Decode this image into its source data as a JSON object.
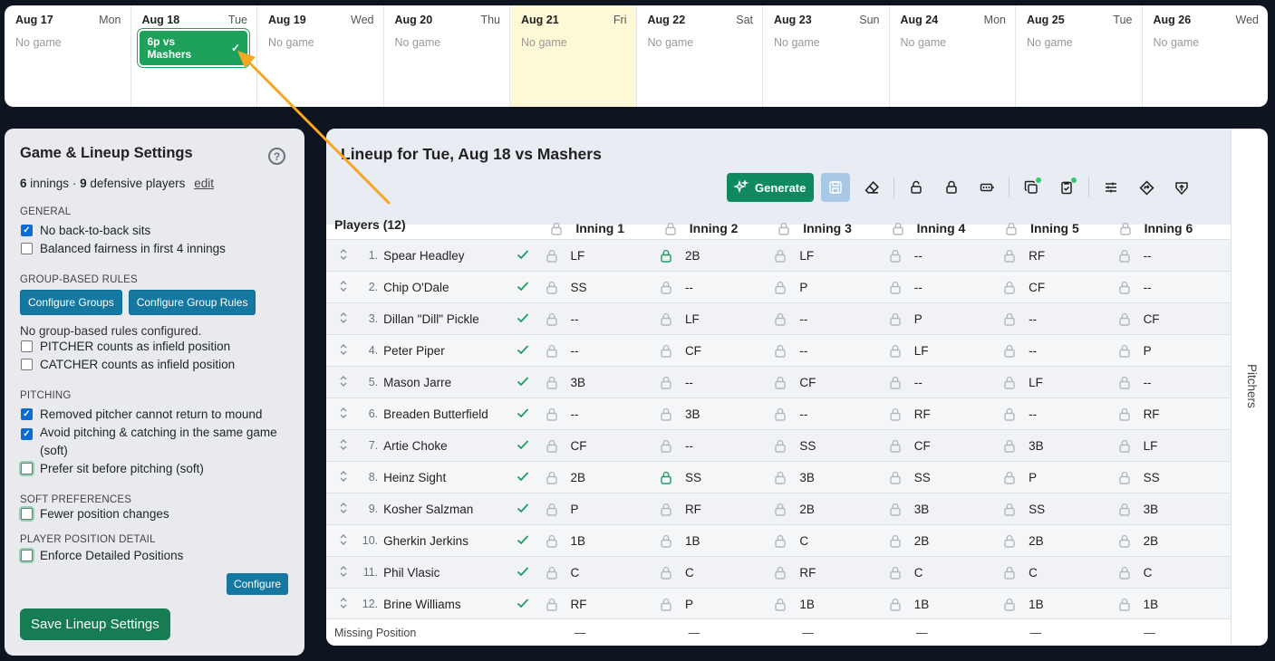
{
  "calendar": [
    {
      "date": "Aug 17",
      "dow": "Mon",
      "status": "No game"
    },
    {
      "date": "Aug 18",
      "dow": "Tue",
      "game": "6p vs Mashers",
      "check": "✓"
    },
    {
      "date": "Aug 19",
      "dow": "Wed",
      "status": "No game"
    },
    {
      "date": "Aug 20",
      "dow": "Thu",
      "status": "No game"
    },
    {
      "date": "Aug 21",
      "dow": "Fri",
      "status": "No game"
    },
    {
      "date": "Aug 22",
      "dow": "Sat",
      "status": "No game"
    },
    {
      "date": "Aug 23",
      "dow": "Sun",
      "status": "No game"
    },
    {
      "date": "Aug 24",
      "dow": "Mon",
      "status": "No game"
    },
    {
      "date": "Aug 25",
      "dow": "Tue",
      "status": "No game"
    },
    {
      "date": "Aug 26",
      "dow": "Wed",
      "status": "No game"
    }
  ],
  "settings": {
    "title": "Game & Lineup Settings",
    "help": "?",
    "innings": "6",
    "innings_label": "innings ·",
    "players": "9",
    "players_label": "defensive players",
    "edit": "edit",
    "general": "GENERAL",
    "no_b2b": "No back-to-back sits",
    "balanced": "Balanced fairness in first 4 innings",
    "group_rules": "GROUP-BASED RULES",
    "cfg_groups": "Configure Groups",
    "cfg_group_rules": "Configure Group Rules",
    "no_group": "No group-based rules configured.",
    "pitcher_if": "PITCHER counts as infield position",
    "catcher_if": "CATCHER counts as infield position",
    "pitching": "PITCHING",
    "removed": "Removed pitcher cannot return to mound",
    "avoid": "Avoid pitching & catching in the same game (soft)",
    "prefer": "Prefer sit before pitching (soft)",
    "soft": "SOFT PREFERENCES",
    "fewer": "Fewer position changes",
    "detail": "PLAYER POSITION DETAIL",
    "enforce": "Enforce Detailed Positions",
    "configure": "Configure",
    "save": "Save Lineup Settings"
  },
  "lineup": {
    "title": "Lineup for Tue, Aug 18 vs Mashers",
    "generate": "Generate",
    "players_header": "Players (12)",
    "innings": [
      "Inning 1",
      "Inning 2",
      "Inning 3",
      "Inning 4",
      "Inning 5",
      "Inning 6"
    ],
    "missing": "Missing Position",
    "missing_vals": [
      "—",
      "—",
      "—",
      "—",
      "—",
      "—"
    ],
    "rows": [
      {
        "n": "1.",
        "name": "Spear Headley",
        "pos": [
          "LF",
          "2B",
          "LF",
          "--",
          "RF",
          "--"
        ],
        "locked": [
          false,
          true,
          false,
          false,
          false,
          false
        ]
      },
      {
        "n": "2.",
        "name": "Chip O'Dale",
        "pos": [
          "SS",
          "--",
          "P",
          "--",
          "CF",
          "--"
        ],
        "locked": [
          false,
          false,
          false,
          false,
          false,
          false
        ]
      },
      {
        "n": "3.",
        "name": "Dillan \"Dill\" Pickle",
        "pos": [
          "--",
          "LF",
          "--",
          "P",
          "--",
          "CF"
        ],
        "locked": [
          false,
          false,
          false,
          false,
          false,
          false
        ]
      },
      {
        "n": "4.",
        "name": "Peter Piper",
        "pos": [
          "--",
          "CF",
          "--",
          "LF",
          "--",
          "P"
        ],
        "locked": [
          false,
          false,
          false,
          false,
          false,
          false
        ]
      },
      {
        "n": "5.",
        "name": "Mason Jarre",
        "pos": [
          "3B",
          "--",
          "CF",
          "--",
          "LF",
          "--"
        ],
        "locked": [
          false,
          false,
          false,
          false,
          false,
          false
        ]
      },
      {
        "n": "6.",
        "name": "Breaden Butterfield",
        "pos": [
          "--",
          "3B",
          "--",
          "RF",
          "--",
          "RF"
        ],
        "locked": [
          false,
          false,
          false,
          false,
          false,
          false
        ]
      },
      {
        "n": "7.",
        "name": "Artie Choke",
        "pos": [
          "CF",
          "--",
          "SS",
          "CF",
          "3B",
          "LF"
        ],
        "locked": [
          false,
          false,
          false,
          false,
          false,
          false
        ]
      },
      {
        "n": "8.",
        "name": "Heinz Sight",
        "pos": [
          "2B",
          "SS",
          "3B",
          "SS",
          "P",
          "SS"
        ],
        "locked": [
          false,
          true,
          false,
          false,
          false,
          false
        ]
      },
      {
        "n": "9.",
        "name": "Kosher Salzman",
        "pos": [
          "P",
          "RF",
          "2B",
          "3B",
          "SS",
          "3B"
        ],
        "locked": [
          false,
          false,
          false,
          false,
          false,
          false
        ]
      },
      {
        "n": "10.",
        "name": "Gherkin Jerkins",
        "pos": [
          "1B",
          "1B",
          "C",
          "2B",
          "2B",
          "2B"
        ],
        "locked": [
          false,
          false,
          false,
          false,
          false,
          false
        ]
      },
      {
        "n": "11.",
        "name": "Phil Vlasic",
        "pos": [
          "C",
          "C",
          "RF",
          "C",
          "C",
          "C"
        ],
        "locked": [
          false,
          false,
          false,
          false,
          false,
          false
        ]
      },
      {
        "n": "12.",
        "name": "Brine Williams",
        "pos": [
          "RF",
          "P",
          "1B",
          "1B",
          "1B",
          "1B"
        ],
        "locked": [
          false,
          false,
          false,
          false,
          false,
          false
        ]
      }
    ]
  },
  "pitchers_tab": "Pitchers",
  "colors": {
    "accent": "#1ea15a",
    "today": "#fdf8d6",
    "arrow": "#f5a623",
    "lock_on": "#1e9d62"
  }
}
